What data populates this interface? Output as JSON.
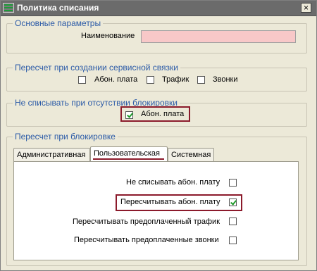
{
  "window": {
    "title": "Политика списания",
    "close_symbol": "×",
    "icon": "app-menu-icon"
  },
  "basic": {
    "legend": "Основные параметры",
    "name_label": "Наименование",
    "name_value": "",
    "name_field_color": "#f8c8c8"
  },
  "recalc_service": {
    "legend": "Пересчет при создании сервисной связки",
    "items": [
      {
        "label": "Абон. плата",
        "checked": false
      },
      {
        "label": "Трафик",
        "checked": false
      },
      {
        "label": "Звонки",
        "checked": false
      }
    ]
  },
  "no_charge": {
    "legend": "Не списывать при отсутствии блокировки",
    "items": [
      {
        "label": "Абон. плата",
        "checked": true
      }
    ]
  },
  "recalc_block": {
    "legend": "Пересчет при блокировке",
    "tabs": [
      {
        "label": "Административная",
        "active": false
      },
      {
        "label": "Пользовательская",
        "active": true
      },
      {
        "label": "Системная",
        "active": false
      }
    ],
    "options": [
      {
        "label": "Не списывать абон. плату",
        "checked": false
      },
      {
        "label": "Пересчитывать абон. плату",
        "checked": true
      },
      {
        "label": "Пересчитывать предоплаченный трафик",
        "checked": false
      },
      {
        "label": "Пересчитывать предоплаченные звонки",
        "checked": false
      }
    ]
  },
  "colors": {
    "title_bar": "#6b6b6b",
    "legend_text": "#2c5ba7",
    "highlight_box": "#8b1a2b",
    "check_mark": "#1f9a2a"
  }
}
